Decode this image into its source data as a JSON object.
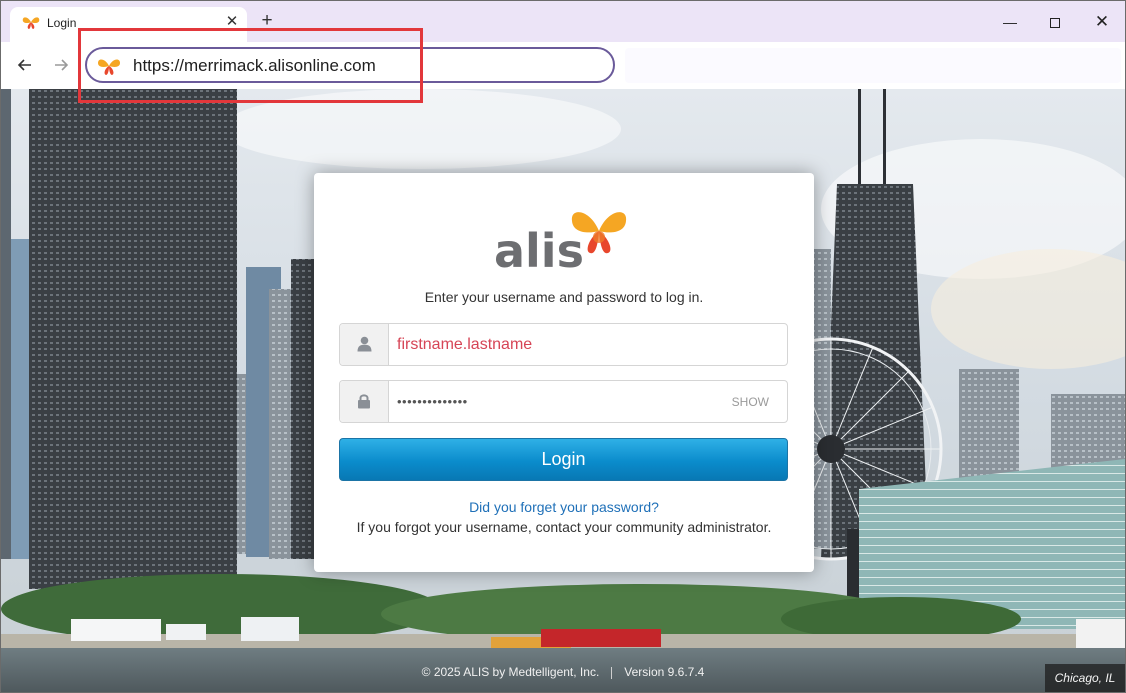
{
  "browser": {
    "tab_title": "Login",
    "tab_close": "✕",
    "new_tab": "+",
    "url": "https://merrimack.alisonline.com",
    "back_icon": "arrow-left-icon",
    "forward_icon": "arrow-right-icon",
    "minimize": "—",
    "close": "✕"
  },
  "login": {
    "brand": "alis",
    "instructions": "Enter your username and password to log in.",
    "username_value": "firstname.lastname",
    "password_value": "••••••••••••••",
    "show_label": "SHOW",
    "login_label": "Login",
    "forgot_password": "Did you forget your password?",
    "forgot_username": "If you forgot your username, contact your community administrator."
  },
  "footer": {
    "copyright": "© 2025 ALIS by Medtelligent, Inc.",
    "version": "Version 9.6.7.4",
    "location": "Chicago, IL"
  },
  "colors": {
    "brand_orange": "#f5a623",
    "brand_red": "#e8472c",
    "brand_gray": "#6d6e71",
    "login_blue": "#0b8ccc",
    "link_blue": "#1f70b8",
    "highlight_red": "#e2373b"
  }
}
